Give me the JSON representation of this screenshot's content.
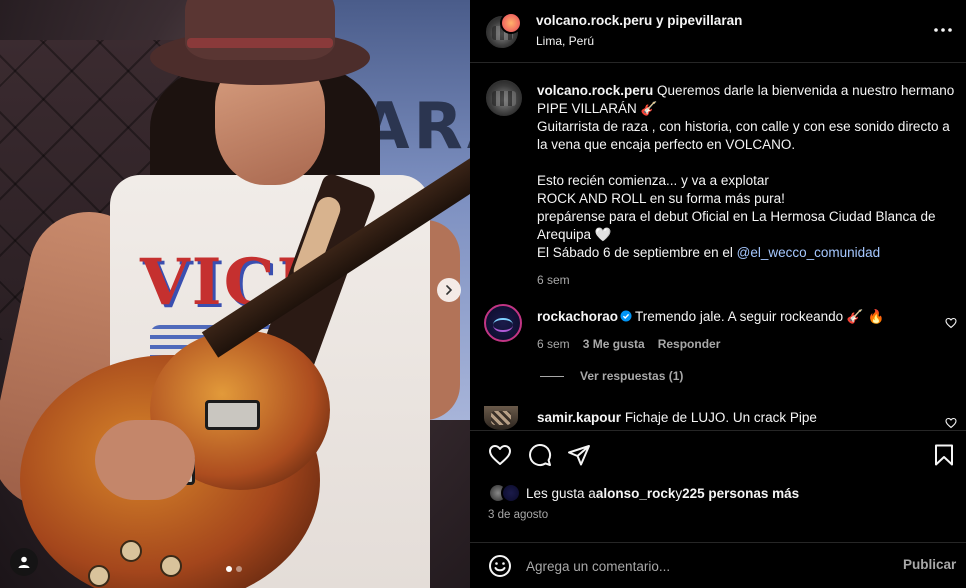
{
  "header": {
    "usernames": "volcano.rock.peru y pipevillaran",
    "location": "Lima, Perú",
    "more_icon": "more-horizontal-icon"
  },
  "photo": {
    "wall_text": "ARA",
    "shirt_text": "VICE",
    "carousel_active_index": 0,
    "carousel_count": 2
  },
  "caption": {
    "username": "volcano.rock.peru",
    "text_part1": " Queremos darle la bienvenida a nuestro hermano PIPE VILLARÁN 🎸\nGuitarrista de raza , con historia, con calle y con ese sonido directo a la vena que encaja perfecto en VOLCANO.\n\nEsto recién comienza... y va a explotar\nROCK AND ROLL en su forma más pura!\nprepárense para el debut Oficial en La Hermosa Ciudad Blanca de Arequipa 🤍\nEl Sábado 6 de septiembre en el ",
    "mention": "@el_wecco_comunidad",
    "time": "6 sem"
  },
  "comments": [
    {
      "username": "rockachorao",
      "verified": true,
      "text": "Tremendo jale. A seguir rockeando 🎸 🔥",
      "time": "6 sem",
      "likes": "3 Me gusta",
      "reply_label": "Responder",
      "view_replies": "Ver respuestas (1)"
    },
    {
      "username": "samir.kapour",
      "verified": false,
      "text": "Fichaje de LUJO. Un crack Pipe"
    }
  ],
  "likes": {
    "prefix": "Les gusta a ",
    "first_user": "alonso_rock",
    "connector": " y ",
    "others": "225 personas más"
  },
  "post_date": "3 de agosto",
  "comment_box": {
    "placeholder": "Agrega un comentario...",
    "publish_label": "Publicar"
  },
  "colors": {
    "background": "#000000",
    "text": "#f5f5f5",
    "secondary": "#a8a8a8",
    "mention": "#a6c8ff",
    "verified": "#0095f6"
  }
}
